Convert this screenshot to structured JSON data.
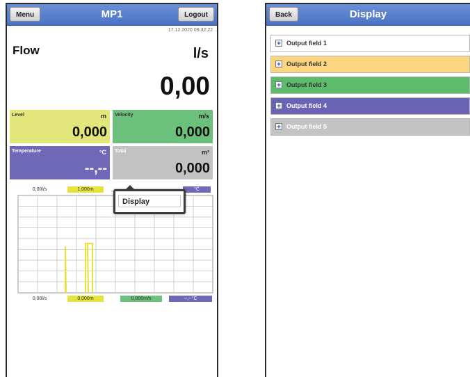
{
  "left_screen": {
    "header": {
      "menu_label": "Menu",
      "title": "MP1",
      "logout_label": "Logout"
    },
    "timestamp": "17.12.2020 09:32:22",
    "flow": {
      "label": "Flow",
      "unit": "l/s",
      "value": "0,00"
    },
    "tiles": [
      {
        "label": "Level",
        "unit": "m",
        "value": "0,000",
        "color": "#e3e67a"
      },
      {
        "label": "Velocity",
        "unit": "m/s",
        "value": "0,000",
        "color": "#6bc17c"
      },
      {
        "label": "Temperature",
        "unit": "°C",
        "value": "--,--",
        "color": "#6f68b8"
      },
      {
        "label": "Total",
        "unit": "m³",
        "value": "0,000",
        "color": "#c3c3c3"
      }
    ],
    "chart_top_chips": [
      "0,00l/s",
      "1,000m",
      "°C"
    ],
    "chart_bottom_chips": [
      "0,00l/s",
      "0,000m",
      "0,000m/s",
      "--,--°C"
    ],
    "popup": {
      "item_label": "Display"
    }
  },
  "right_screen": {
    "header": {
      "back_label": "Back",
      "title": "Display"
    },
    "fields": [
      {
        "label": "Output field 1",
        "color": "#ffffff"
      },
      {
        "label": "Output field 2",
        "color": "#fcd67e"
      },
      {
        "label": "Output field 3",
        "color": "#5cbc6c"
      },
      {
        "label": "Output field 4",
        "color": "#6a63b6"
      },
      {
        "label": "Output field 5",
        "color": "#c3c3c3"
      }
    ]
  },
  "colors": {
    "header_blue": "#4a73c4",
    "trace_yellow": "#e6e43a",
    "grid": "#cfcfcf"
  }
}
